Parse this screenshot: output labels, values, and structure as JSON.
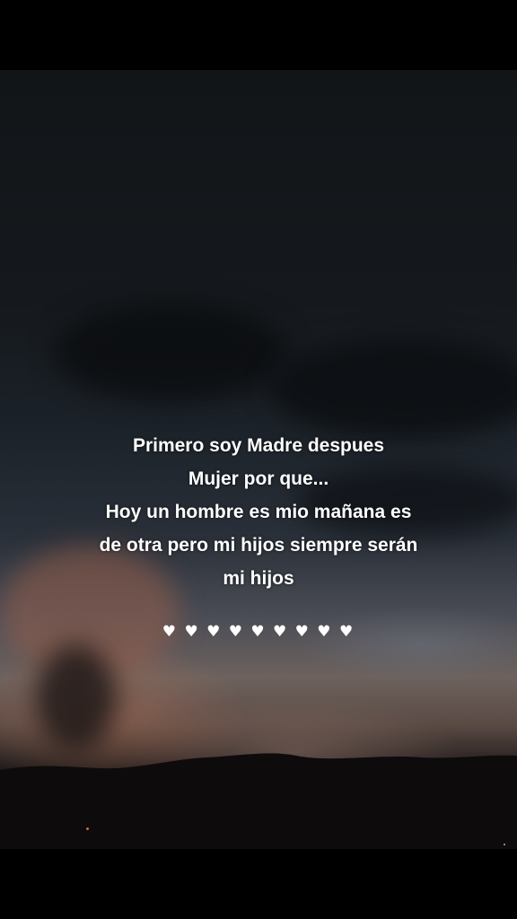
{
  "caption": {
    "lines": [
      "Primero soy Madre despues",
      "Mujer por que...",
      "Hoy un hombre es mio mañana es",
      "de otra pero mi hijos siempre serán",
      "mi hijos"
    ]
  },
  "decoration": {
    "hearts": "♥ ♥ ♥ ♥ ♥ ♥ ♥ ♥ ♥",
    "icon": "heart-icon"
  },
  "colors": {
    "text": "#ffffff",
    "letterbox": "#000000",
    "sky_dark": "#15191d",
    "sunset_glow": "#6d625e"
  }
}
